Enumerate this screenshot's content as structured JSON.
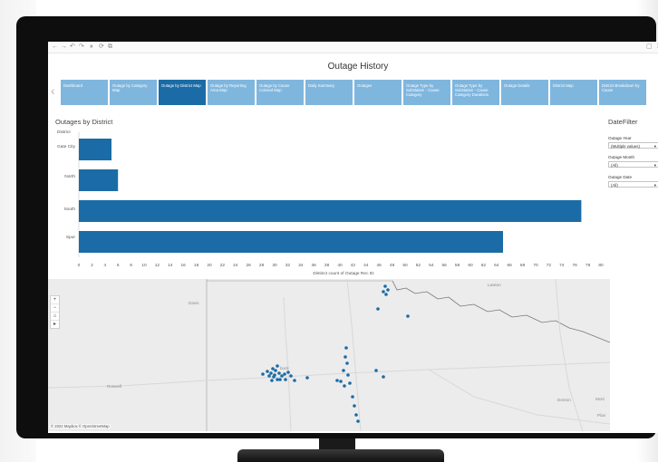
{
  "dashboard": {
    "title": "Outage History"
  },
  "tabs": [
    {
      "label": "Dashboard"
    },
    {
      "label": "Outage by Category Map"
    },
    {
      "label": "Outage by District Map"
    },
    {
      "label": "Outage by Reporting Area Map"
    },
    {
      "label": "Outage by Cause Colored Map"
    },
    {
      "label": "Daily Summary"
    },
    {
      "label": "Outages"
    },
    {
      "label": "Outage Type by Substation - Cause Category"
    },
    {
      "label": "Outage Type by Substation - Cause Category Durations"
    },
    {
      "label": "Outage Details"
    },
    {
      "label": "District Map"
    },
    {
      "label": "District Breakdown by Cause"
    }
  ],
  "active_tab": "Outage by District Map",
  "section": {
    "title": "Outages by District",
    "column_header": "District"
  },
  "chart_data": {
    "type": "bar",
    "orientation": "horizontal",
    "categories": [
      "Gate City",
      "North",
      "South",
      "Spur"
    ],
    "values": [
      5,
      6,
      77,
      65
    ],
    "xlabel": "Distinct count of Outage Rec ID",
    "xticks": [
      0,
      2,
      4,
      6,
      8,
      10,
      12,
      14,
      16,
      18,
      20,
      22,
      24,
      26,
      28,
      30,
      32,
      34,
      36,
      38,
      40,
      42,
      44,
      46,
      48,
      50,
      52,
      54,
      56,
      58,
      60,
      62,
      64,
      66,
      68,
      70,
      72,
      74,
      76,
      78,
      80
    ],
    "xlim": [
      0,
      80
    ],
    "grid": false,
    "bar_color": "#1b6ca6"
  },
  "filters": {
    "title": "DateFilter",
    "items": [
      {
        "label": "Outage Year",
        "value": "(Multiple values)"
      },
      {
        "label": "Outage Month",
        "value": "(All)"
      },
      {
        "label": "Outage Date",
        "value": "(All)"
      }
    ]
  },
  "map": {
    "towns": [
      {
        "name": "Lawton"
      },
      {
        "name": "Davis"
      },
      {
        "name": "Lubbock",
        "display": "bock"
      },
      {
        "name": "Roswell"
      },
      {
        "name": "Denton"
      },
      {
        "name": "McKinney",
        "display": "McKi"
      },
      {
        "name": "Plano",
        "display": "Plan"
      }
    ],
    "attribution": "© 2022 Mapbox © OpenStreetMap",
    "controls": [
      "+",
      "−",
      "⌂",
      "▸"
    ],
    "point_color": "#1b6ca6"
  },
  "colors": {
    "tab": "#7fb6de",
    "tab_active": "#1b6ca6",
    "bar": "#1b6ca6",
    "map_bg": "#ececec"
  }
}
